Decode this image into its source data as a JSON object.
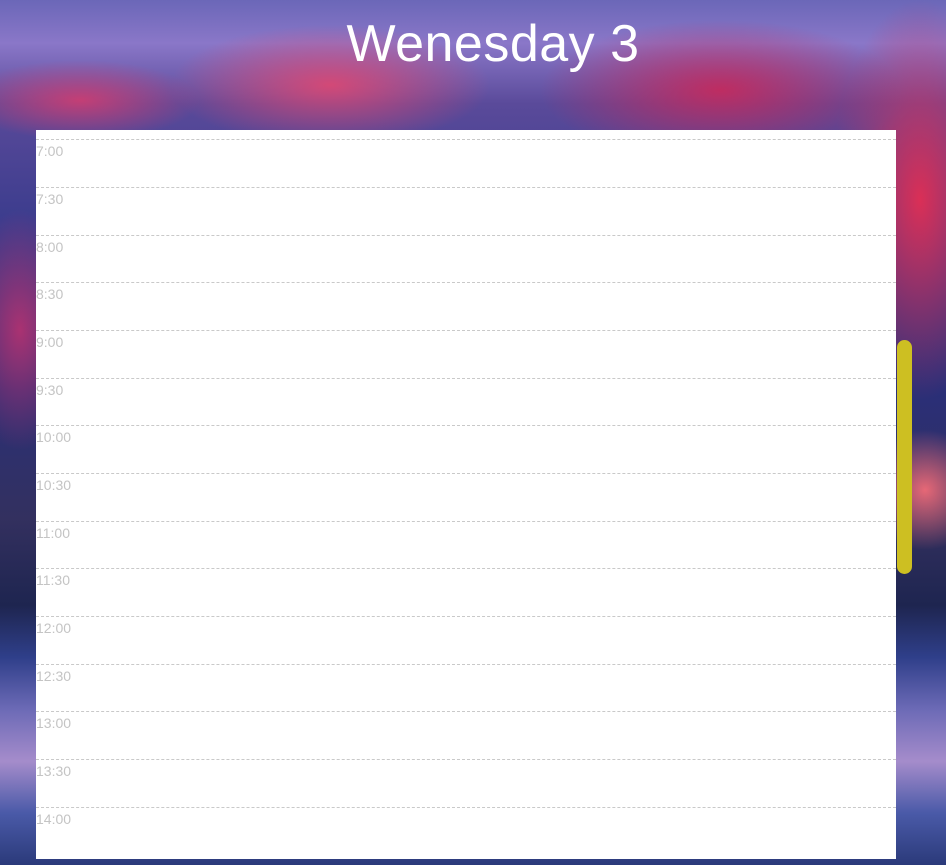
{
  "header": {
    "title": "Wenesday 3"
  },
  "schedule": {
    "slots": [
      {
        "time": "7:00"
      },
      {
        "time": "7:30"
      },
      {
        "time": "8:00"
      },
      {
        "time": "8:30"
      },
      {
        "time": "9:00"
      },
      {
        "time": "9:30"
      },
      {
        "time": "10:00"
      },
      {
        "time": "10:30"
      },
      {
        "time": "11:00"
      },
      {
        "time": "11:30"
      },
      {
        "time": "12:00"
      },
      {
        "time": "12:30"
      },
      {
        "time": "13:00"
      },
      {
        "time": "13:30"
      },
      {
        "time": "14:00"
      }
    ]
  },
  "colors": {
    "scrollbar_thumb": "#cdbf22",
    "panel_background": "#ffffff",
    "time_label": "#c4c4c4"
  }
}
